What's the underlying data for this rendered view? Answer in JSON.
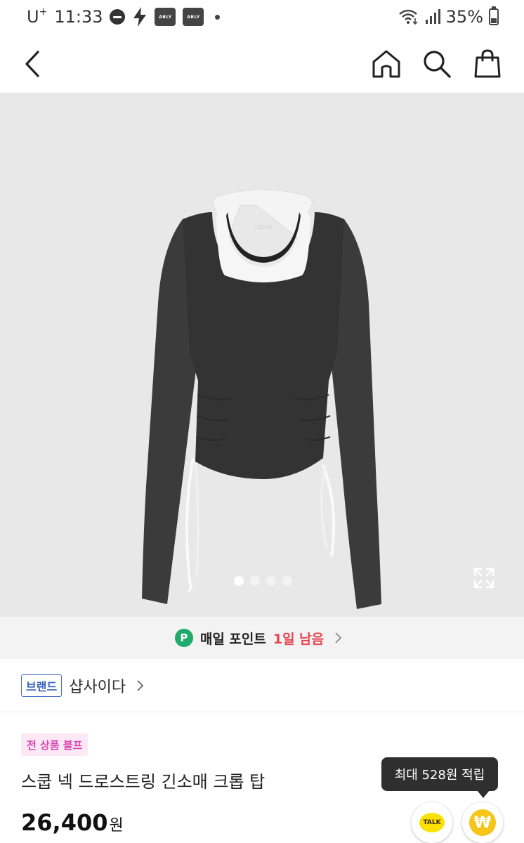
{
  "status_bar": {
    "carrier": "U",
    "carrier_sup": "+",
    "time": "11:33",
    "app_badges": [
      "ABLY",
      "ABLY"
    ],
    "battery": "35%"
  },
  "nav": {
    "icons": [
      "back-icon",
      "home-icon",
      "search-icon",
      "shopping-bag-icon"
    ]
  },
  "hero": {
    "image_subject": "black long-sleeve scoop neck drawstring crop top with white layered tank",
    "garment_label": "CIDER",
    "slide_count": 4,
    "active_slide": 1
  },
  "point_banner": {
    "badge": "P",
    "text": "매일 포인트",
    "highlight": "1일 남음"
  },
  "brand": {
    "tag": "브랜드",
    "name": "샵사이다"
  },
  "product": {
    "sale_tag": "전 상품 블프",
    "title": "스쿱 넥 드로스트링 긴소매 크롭 탑",
    "price": "26,400",
    "price_unit": "원"
  },
  "tooltip": {
    "text": "최대 528원 적립"
  },
  "fabs": {
    "talk_label": "TALK",
    "point_symbol": "₩"
  },
  "colors": {
    "point_green": "#1eaa68",
    "highlight_red": "#e8454f",
    "brand_blue": "#3b63c2",
    "sale_pink": "#d946b4",
    "kakao_yellow": "#fae100"
  }
}
